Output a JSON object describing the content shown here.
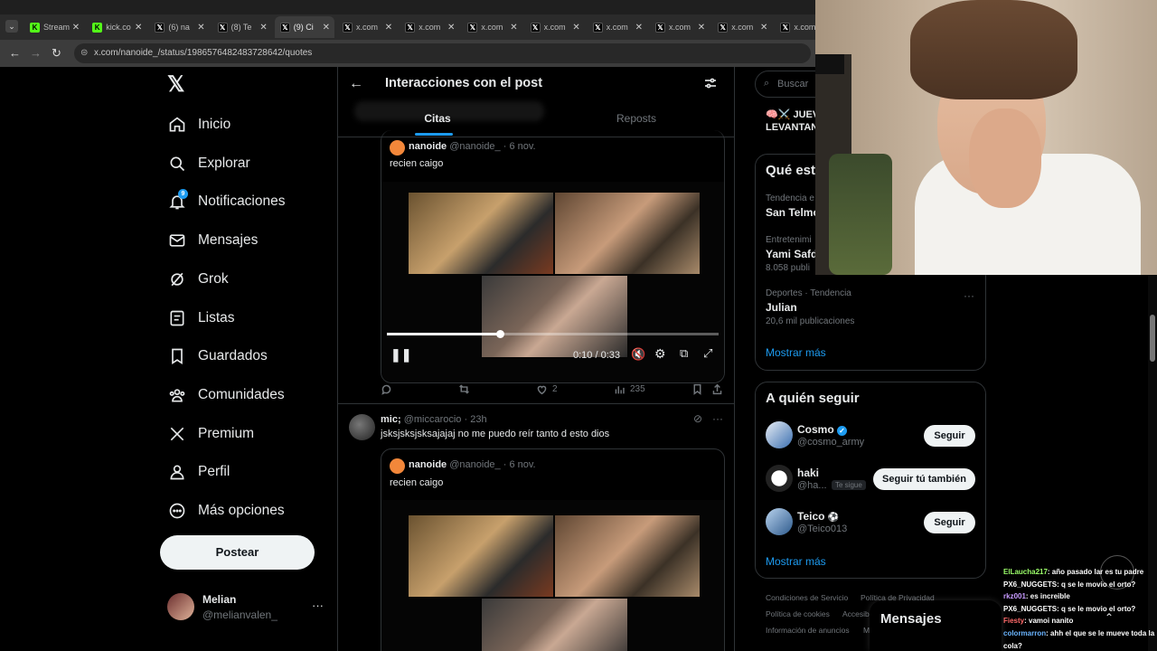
{
  "browser": {
    "tabs": [
      {
        "label": "Stream",
        "icon": "kick-icon"
      },
      {
        "label": "kick.co",
        "icon": "kick-icon"
      },
      {
        "label": "(6) na",
        "icon": "x-icon"
      },
      {
        "label": "(8) Te",
        "icon": "x-icon"
      },
      {
        "label": "(9) Ci",
        "icon": "x-icon"
      },
      {
        "label": "x.com",
        "icon": "x-icon"
      },
      {
        "label": "x.com",
        "icon": "x-icon"
      },
      {
        "label": "x.com",
        "icon": "x-icon"
      },
      {
        "label": "x.com",
        "icon": "x-icon"
      },
      {
        "label": "x.com",
        "icon": "x-icon"
      },
      {
        "label": "x.com",
        "icon": "x-icon"
      },
      {
        "label": "x.com",
        "icon": "x-icon"
      },
      {
        "label": "x.com",
        "icon": "x-icon"
      }
    ],
    "url": "x.com/nanoide_/status/1986576482483728642/quotes"
  },
  "sidebar": {
    "items": [
      {
        "label": "Inicio",
        "icon": "home-icon"
      },
      {
        "label": "Explorar",
        "icon": "search-icon"
      },
      {
        "label": "Notificaciones",
        "icon": "bell-icon",
        "badge": "9"
      },
      {
        "label": "Mensajes",
        "icon": "mail-icon"
      },
      {
        "label": "Grok",
        "icon": "grok-icon"
      },
      {
        "label": "Listas",
        "icon": "list-icon"
      },
      {
        "label": "Guardados",
        "icon": "bookmark-icon"
      },
      {
        "label": "Comunidades",
        "icon": "communities-icon"
      },
      {
        "label": "Premium",
        "icon": "x-logo-icon"
      },
      {
        "label": "Perfil",
        "icon": "person-icon"
      },
      {
        "label": "Más opciones",
        "icon": "more-circle-icon"
      }
    ],
    "post_button": "Postear",
    "account": {
      "name": "Melian",
      "handle": "@melianvalen_"
    }
  },
  "main": {
    "header_title": "Interacciones con el post",
    "tabs": [
      {
        "label": "Citas",
        "active": true
      },
      {
        "label": "Reposts",
        "active": false
      }
    ],
    "quoted_post": {
      "author": "nanoide",
      "handle": "@nanoide_",
      "date": "· 6 nov.",
      "text": "recien caigo",
      "video_time": "0:10 / 0:33",
      "video_progress": 0.34
    },
    "actions": {
      "replies": "",
      "reposts": "",
      "likes": "2",
      "views": "235"
    },
    "second_post": {
      "author": "mic;",
      "handle": "@miccarocio",
      "time": "· 23h",
      "text": "jsksjsksjsksajajaj no me puedo reír tanto d esto dios",
      "quote_author": "nanoide",
      "quote_handle": "@nanoide_",
      "quote_date": "· 6 nov.",
      "quote_text": "recien caigo"
    }
  },
  "right": {
    "search_placeholder": "Buscar",
    "banner": "🧠⚔️ JUEV",
    "banner2": "LEVANTAN",
    "trends_title": "Qué est",
    "trends": [
      {
        "context": "Tendencia e",
        "name": "San Telmo",
        "count": ""
      },
      {
        "context": "Entretenimi",
        "name": "Yami Safd",
        "count": "8.058 publi"
      },
      {
        "context": "Deportes · Tendencia",
        "name": "Julian",
        "count": "20,6 mil publicaciones"
      }
    ],
    "show_more": "Mostrar más",
    "follow_title": "A quién seguir",
    "follow": [
      {
        "name": "Cosmo",
        "handle": "@cosmo_army",
        "button": "Seguir",
        "verified": true,
        "follows_you": ""
      },
      {
        "name": "haki",
        "handle": "@ha...",
        "button": "Seguir tú también",
        "verified": false,
        "follows_you": "Te sigue"
      },
      {
        "name": "Teico",
        "handle": "@Teico013",
        "button": "Seguir",
        "verified": false,
        "follows_you": ""
      }
    ],
    "follow_show_more": "Mostrar más",
    "footer": [
      "Condiciones de Servicio",
      "Política de Privacidad",
      "Política de cookies",
      "Accesib",
      "Información de anuncios",
      "M"
    ],
    "messages_drawer": "Mensajes"
  },
  "chat": [
    {
      "user": "ElLaucha217",
      "user_color": "#9cff6a",
      "text": ": año pasado lar es tu padre"
    },
    {
      "user": "PX6_NUGGETS",
      "user_color": "#ffffff",
      "text": ": q se le movio el orto?"
    },
    {
      "user": "rkz001",
      "user_color": "#c89bff",
      "text": ": es increible"
    },
    {
      "user": "PX6_NUGGETS",
      "user_color": "#ffffff",
      "text": ": q se le movio el orto?"
    },
    {
      "user": "Fiesty",
      "user_color": "#ff6a6a",
      "text": ": vamoi nanito"
    },
    {
      "user": "colormarron",
      "user_color": "#6ab4ff",
      "text": ": ahh el que se le mueve toda la"
    },
    {
      "user": "",
      "user_color": "#ffffff",
      "text": "cola?"
    }
  ],
  "colors": {
    "accent": "#1d9bf0",
    "bg": "#000000",
    "border": "#2f3336",
    "muted": "#71767b"
  }
}
